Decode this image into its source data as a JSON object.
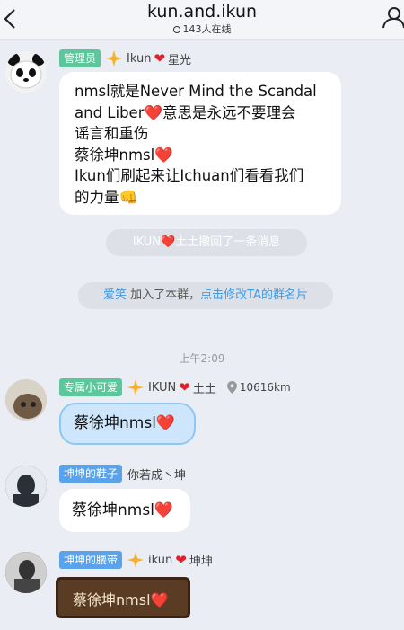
{
  "header": {
    "title": "kun.and.ikun",
    "online": "143人在线"
  },
  "messages": [
    {
      "badge": "管理员",
      "name_a": "Ikun",
      "name_b": "星光",
      "lines": [
        "nmsl就是Never Mind the Scandal",
        "and Liber❤️意思是永远不要理会",
        "谣言和重伤",
        "蔡徐坤nmsl❤️",
        "Ikun们刷起来让Ichuan们看看我们",
        "的力量👊"
      ]
    },
    {
      "badge": "专属小可爱",
      "name_a": "IKUN",
      "name_b": "土土",
      "location": "10616km",
      "text": "蔡徐坤nmsl❤️"
    },
    {
      "badge": "坤坤的鞋子",
      "name_a": "你若成丶坤",
      "text": "蔡徐坤nmsl❤️"
    },
    {
      "badge": "坤坤的腰带",
      "name_a": "ikun",
      "name_b": "坤坤",
      "text": "蔡徐坤nmsl❤️"
    }
  ],
  "system": {
    "recall": "IKUN❤️土土撤回了一条消息",
    "join_user": "爱笑",
    "join_text": " 加入了本群，",
    "join_link": "点击修改TA的群名片"
  },
  "timestamp": "上午2:09",
  "colors": {
    "badge_green": "#5bc79a",
    "badge_blue": "#5aa2e9",
    "link": "#3e9be8",
    "heart": "#e0212b"
  }
}
